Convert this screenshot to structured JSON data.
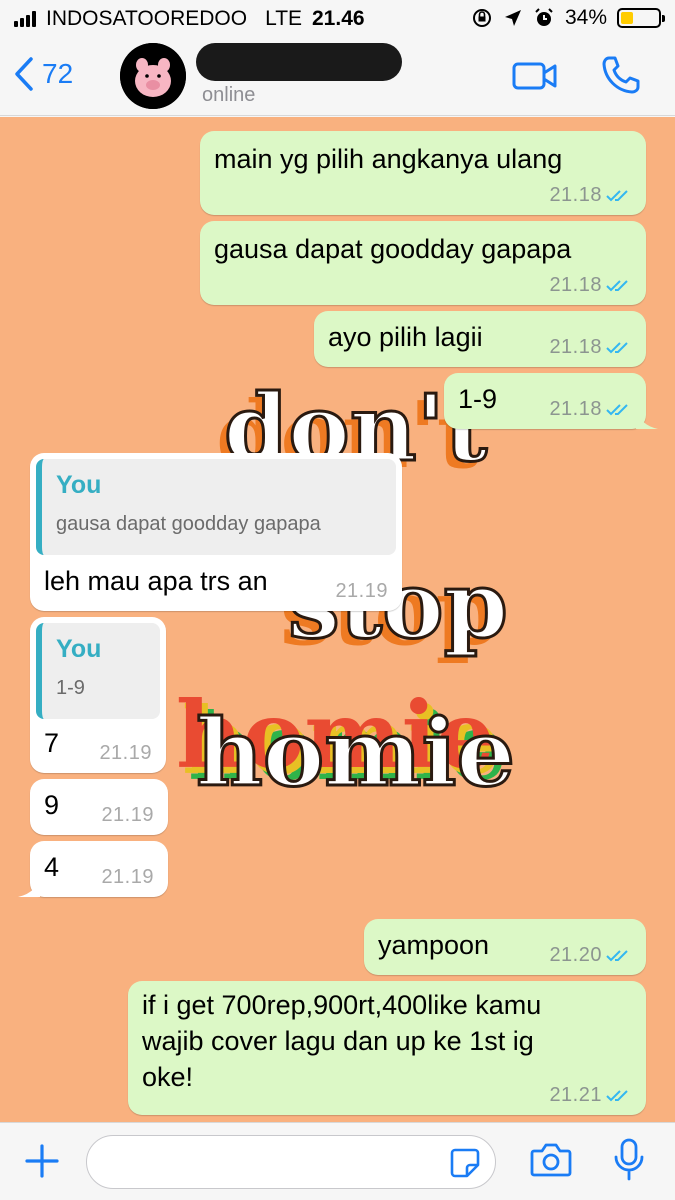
{
  "status_bar": {
    "carrier": "INDOSATOOREDOO",
    "network": "LTE",
    "time": "21.46",
    "battery": "34%",
    "battery_level": 0.34
  },
  "header": {
    "back_count": "72",
    "contact_status": "online"
  },
  "messages": [
    {
      "direction": "out",
      "text": "main yg pilih angkanya ulang",
      "time": "21.18",
      "read": true
    },
    {
      "direction": "out",
      "text": "gausa dapat goodday gapapa",
      "time": "21.18",
      "read": true
    },
    {
      "direction": "out",
      "text": "ayo pilih lagii",
      "time": "21.18",
      "read": true
    },
    {
      "direction": "out",
      "text": "1-9",
      "time": "21.18",
      "read": true
    },
    {
      "direction": "in",
      "quote_name": "You",
      "quote_text": "gausa dapat goodday gapapa",
      "text": "leh mau apa trs an",
      "time": "21.19"
    },
    {
      "direction": "in",
      "quote_name": "You",
      "quote_text": "1-9",
      "text": "7",
      "time": "21.19"
    },
    {
      "direction": "in",
      "text": "9",
      "time": "21.19"
    },
    {
      "direction": "in",
      "text": "4",
      "time": "21.19"
    },
    {
      "direction": "out",
      "text": "yampoon",
      "time": "21.20",
      "read": true
    },
    {
      "direction": "out",
      "lines": [
        "if i get 700rep,900rt,400like kamu",
        "wajib cover lagu dan up ke 1st ig",
        "oke!"
      ],
      "time": "21.21",
      "read": true
    }
  ],
  "wallpaper": {
    "words": [
      "don't",
      "stop",
      "homie"
    ],
    "background": "#f9b17f"
  },
  "colors": {
    "accent": "#1a7cf5",
    "outgoing_bubble": "#dcf8c6",
    "incoming_bubble": "#ffffff",
    "quote_accent": "#35aec3",
    "read_ticks": "#34b7f1"
  },
  "icons": {
    "back": "chevron-left-icon",
    "video_call": "video-camera-icon",
    "voice_call": "phone-icon",
    "add": "plus-icon",
    "sticker": "sticker-icon",
    "camera": "camera-icon",
    "mic": "microphone-icon"
  }
}
